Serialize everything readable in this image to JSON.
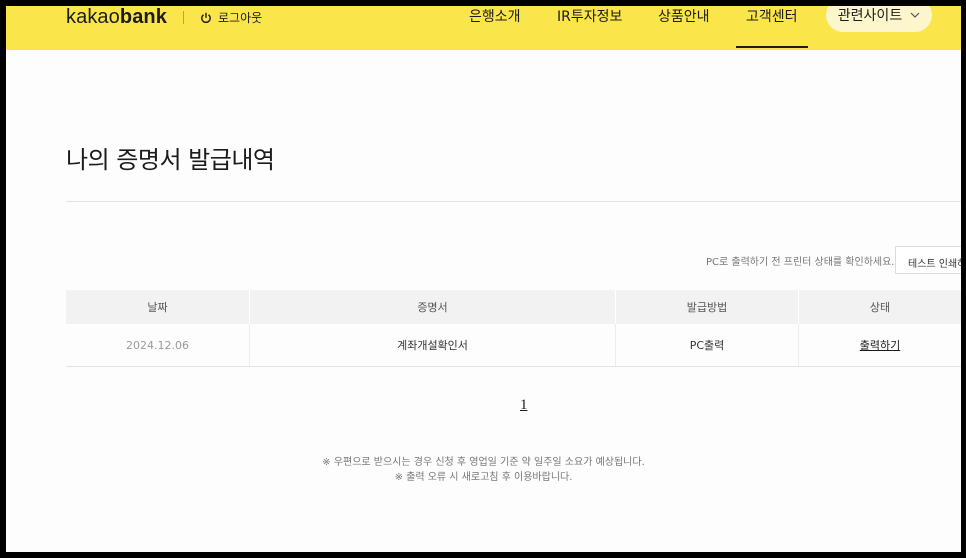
{
  "header": {
    "logo_light": "kakao",
    "logo_bold": "bank",
    "logout_label": "로그아웃",
    "nav": [
      "은행소개",
      "IR투자정보",
      "상품안내",
      "고객센터"
    ],
    "active_nav": "고객센터",
    "related_label": "관련사이트",
    "colors": {
      "header_bg": "#fae54a",
      "text": "#1c1c1c"
    }
  },
  "main": {
    "title": "나의 증명서 발급내역",
    "printer_hint": "PC로 출력하기 전 프린터 상태를 확인하세요.",
    "test_print_label": "테스트 인쇄하기",
    "table": {
      "columns": [
        "날짜",
        "증명서",
        "발급방법",
        "상태"
      ],
      "rows": [
        {
          "date": "2024.12.06",
          "certificate": "계좌개설확인서",
          "method": "PC출력",
          "status": "출력하기"
        }
      ]
    },
    "pagination": {
      "current": "1"
    },
    "notes": [
      "※ 우편으로 받으시는 경우 신청 후 영업일 기준 약 일주일 소요가 예상됩니다.",
      "※ 출력 오류 시 새로고침 후 이용바랍니다."
    ]
  }
}
